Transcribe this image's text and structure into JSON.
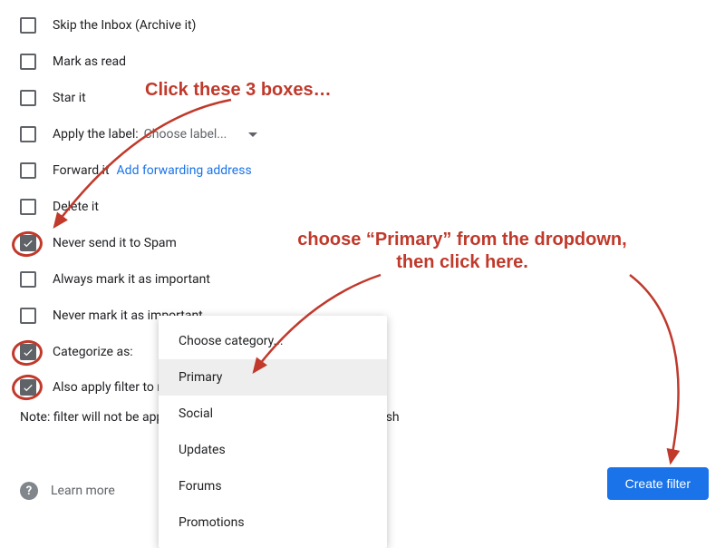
{
  "options": {
    "skip_inbox": "Skip the Inbox (Archive it)",
    "mark_read": "Mark as read",
    "star": "Star it",
    "apply_label": "Apply the label:",
    "choose_label": "Choose label...",
    "forward": "Forward it",
    "add_forward": "Add forwarding address",
    "delete": "Delete it",
    "never_spam": "Never send it to Spam",
    "always_important": "Always mark it as important",
    "never_important": "Never mark it as important",
    "categorize": "Categorize as:",
    "also_apply": "Also apply filter to matching conversations."
  },
  "note": "Note: filter will not be applied to old conversations in Spam or Trash",
  "learn_more": "Learn more",
  "create_filter": "Create filter",
  "dropdown": {
    "head": "Choose category...",
    "items": [
      "Primary",
      "Social",
      "Updates",
      "Forums",
      "Promotions"
    ]
  },
  "annotations": {
    "top": "Click these 3 boxes…",
    "right": "choose “Primary” from the dropdown,\nthen click here."
  },
  "colors": {
    "primary_btn": "#1a73e8",
    "annotation_red": "#c0392b"
  }
}
